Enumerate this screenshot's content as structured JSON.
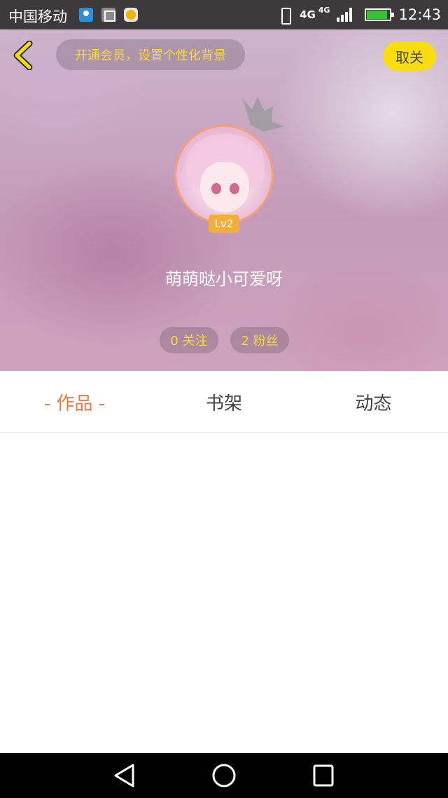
{
  "status_bar": {
    "carrier": "中国移动",
    "network_primary": "4G",
    "network_secondary": "4G",
    "time": "12:43",
    "icons": [
      "location-app-icon",
      "gallery-icon",
      "chat-app-icon",
      "vibrate-icon",
      "signal-icon",
      "battery-charging-icon"
    ]
  },
  "header": {
    "back_icon": "chevron-left-icon",
    "vip_prompt": "开通会员，设置个性化背景",
    "unfollow_label": "取关",
    "crown_icon": "crown-icon",
    "level_badge": "Lv2",
    "nickname": "萌萌哒小可爱呀",
    "stats": {
      "following": "0 关注",
      "fans": "2 粉丝"
    }
  },
  "tabs": [
    {
      "label": "- 作品 -",
      "active": true
    },
    {
      "label": "书架",
      "active": false
    },
    {
      "label": "动态",
      "active": false
    }
  ],
  "nav_bar": {
    "icons": [
      "back-triangle-icon",
      "home-circle-icon",
      "recent-apps-square-icon"
    ]
  },
  "colors": {
    "accent_yellow": "#f7dd12",
    "accent_orange": "#f07a3e",
    "level_badge": "#f4ad36",
    "pill_text": "#f7d73b"
  }
}
